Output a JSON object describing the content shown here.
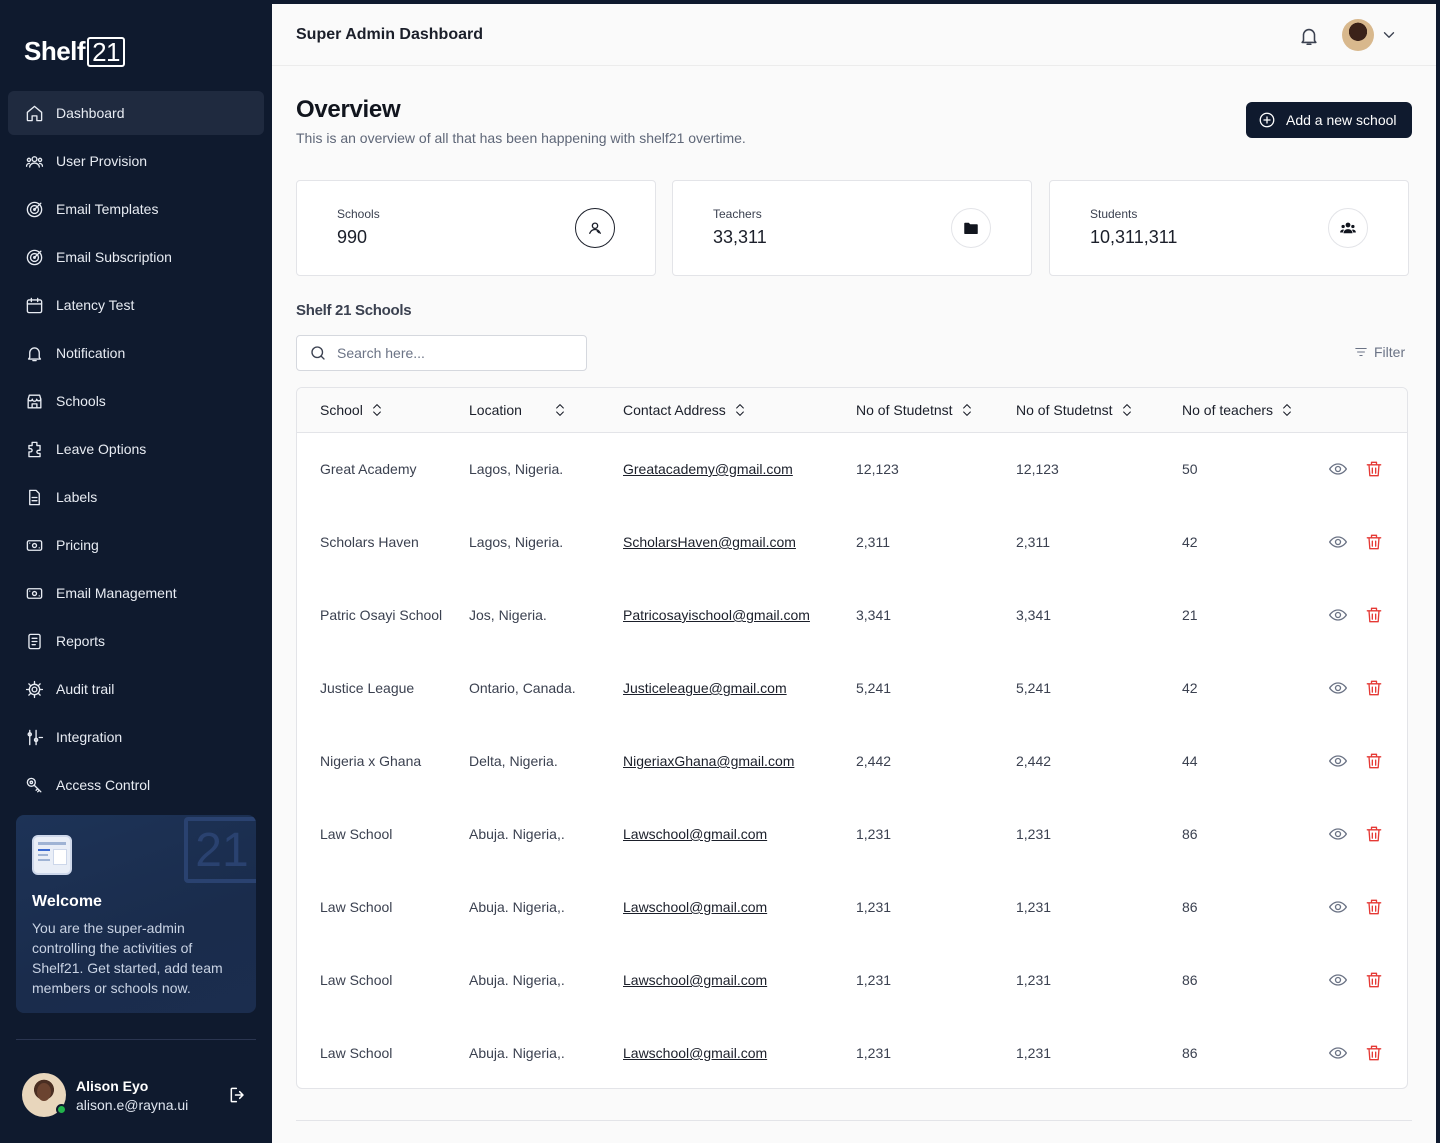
{
  "brand": {
    "name": "Shelf",
    "box": "21"
  },
  "sidebar": {
    "items": [
      {
        "label": "Dashboard",
        "icon": "home-icon",
        "active": true
      },
      {
        "label": "User Provision",
        "icon": "users-icon"
      },
      {
        "label": "Email Templates",
        "icon": "target-icon"
      },
      {
        "label": "Email Subscription",
        "icon": "target-icon"
      },
      {
        "label": "Latency Test",
        "icon": "calendar-icon"
      },
      {
        "label": "Notification",
        "icon": "bell-icon"
      },
      {
        "label": "Schools",
        "icon": "store-icon"
      },
      {
        "label": "Leave Options",
        "icon": "puzzle-icon"
      },
      {
        "label": "Labels",
        "icon": "file-icon"
      },
      {
        "label": "Pricing",
        "icon": "money-icon"
      },
      {
        "label": "Email Management",
        "icon": "money-icon"
      },
      {
        "label": "Reports",
        "icon": "report-icon"
      },
      {
        "label": "Audit trail",
        "icon": "gear-icon"
      },
      {
        "label": "Integration",
        "icon": "sliders-icon"
      },
      {
        "label": "Access Control",
        "icon": "key-icon"
      }
    ],
    "welcome": {
      "title": "Welcome",
      "text": "You are the super-admin controlling the activities of Shelf21. Get started, add team members or schools now.",
      "watermark": "21"
    },
    "user": {
      "name": "Alison Eyo",
      "email": "alison.e@rayna.ui"
    }
  },
  "header": {
    "title": "Super Admin Dashboard"
  },
  "overview": {
    "title": "Overview",
    "subtitle": "This is an overview of all that has been happening with shelf21 overtime.",
    "add_button": "Add a new school"
  },
  "stats": [
    {
      "label": "Schools",
      "value": "990",
      "icon": "user-circle-icon"
    },
    {
      "label": "Teachers",
      "value": "33,311",
      "icon": "folder-icon"
    },
    {
      "label": "Students",
      "value": "10,311,311",
      "icon": "group-icon"
    }
  ],
  "schools_section": {
    "title": "Shelf 21 Schools",
    "search_placeholder": "Search here...",
    "filter_label": "Filter"
  },
  "table": {
    "columns": [
      "School",
      "Location",
      "Contact Address",
      "No of Studetnst",
      "No of Studetnst",
      "No of teachers"
    ],
    "rows": [
      {
        "school": "Great Academy",
        "location": "Lagos, Nigeria.",
        "email": "Greatacademy@gmail.com",
        "students_a": "12,123",
        "students_b": "12,123",
        "teachers": "50"
      },
      {
        "school": "Scholars Haven",
        "location": "Lagos, Nigeria.",
        "email": "ScholarsHaven@gmail.com",
        "students_a": "2,311",
        "students_b": "2,311",
        "teachers": "42"
      },
      {
        "school": "Patric Osayi School",
        "location": "Jos, Nigeria.",
        "email": "Patricosayischool@gmail.com",
        "students_a": "3,341",
        "students_b": "3,341",
        "teachers": "21"
      },
      {
        "school": "Justice League",
        "location": "Ontario, Canada.",
        "email": "Justiceleague@gmail.com",
        "students_a": "5,241",
        "students_b": "5,241",
        "teachers": "42"
      },
      {
        "school": "Nigeria x Ghana",
        "location": "Delta, Nigeria.",
        "email": "NigeriaxGhana@gmail.com",
        "students_a": "2,442",
        "students_b": "2,442",
        "teachers": "44"
      },
      {
        "school": "Law School",
        "location": "Abuja. Nigeria,.",
        "email": "Lawschool@gmail.com",
        "students_a": "1,231",
        "students_b": "1,231",
        "teachers": "86"
      },
      {
        "school": "Law School",
        "location": "Abuja. Nigeria,.",
        "email": "Lawschool@gmail.com",
        "students_a": "1,231",
        "students_b": "1,231",
        "teachers": "86"
      },
      {
        "school": "Law School",
        "location": "Abuja. Nigeria,.",
        "email": "Lawschool@gmail.com",
        "students_a": "1,231",
        "students_b": "1,231",
        "teachers": "86"
      },
      {
        "school": "Law School",
        "location": "Abuja. Nigeria,.",
        "email": "Lawschool@gmail.com",
        "students_a": "1,231",
        "students_b": "1,231",
        "teachers": "86"
      }
    ]
  },
  "colors": {
    "sidebar_bg": "#0f1a2e",
    "accent": "#0f1a2e",
    "danger": "#e53935",
    "online": "#22b34b"
  }
}
